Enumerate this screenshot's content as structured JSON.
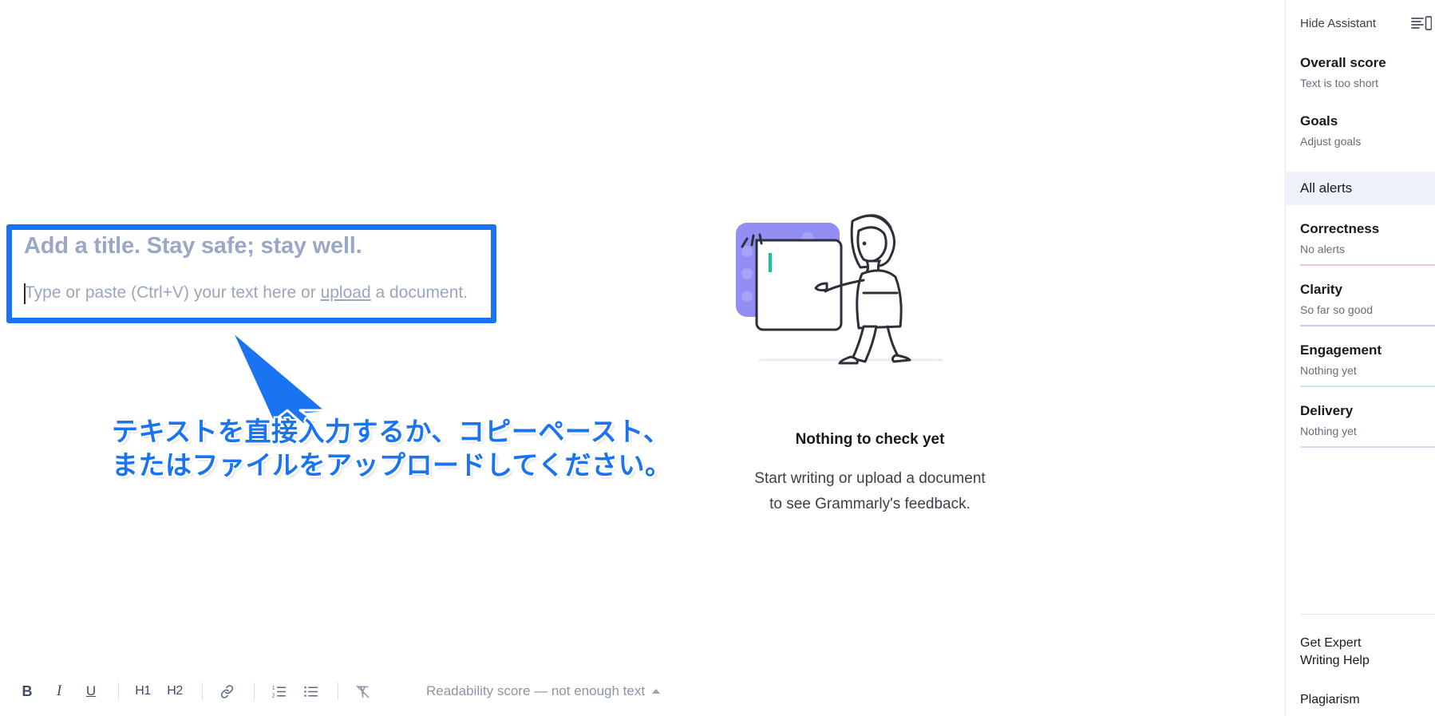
{
  "editor": {
    "title_placeholder": "Add a title. Stay safe; stay well.",
    "body_prefix": "Type or paste (Ctrl+V) your text here or ",
    "body_link": "upload",
    "body_suffix": " a document.",
    "highlight_color": "#1a73f0"
  },
  "annotation": {
    "line1": "テキストを直接入力するか、コピーペースト、",
    "line2": "またはファイルをアップロードしてください。",
    "color": "#1a73f0",
    "arrow_icon": "arrow-pointer-icon"
  },
  "empty_state": {
    "illustration_icon": "person-at-document-illustration",
    "title": "Nothing to check yet",
    "subtitle_line1": "Start writing or upload a document",
    "subtitle_line2": "to see Grammarly's feedback."
  },
  "toolbar": {
    "bold_label": "B",
    "italic_label": "I",
    "underline_label": "U",
    "h1_label": "H1",
    "h2_label": "H2",
    "link_icon": "link-icon",
    "numbered_list_icon": "numbered-list-icon",
    "bulleted_list_icon": "bulleted-list-icon",
    "clear_format_icon": "clear-formatting-icon",
    "readability_text": "Readability score — not enough text"
  },
  "assistant": {
    "hide_label": "Hide Assistant",
    "panel_icon": "side-panel-icon",
    "overall": {
      "title": "Overall score",
      "status": "Text is too short"
    },
    "goals": {
      "title": "Goals",
      "status": "Adjust goals"
    },
    "all_alerts_label": "All alerts",
    "categories": [
      {
        "name": "Correctness",
        "status": "No alerts",
        "color": "#f7c6cf"
      },
      {
        "name": "Clarity",
        "status": "So far so good",
        "color": "#c3cdf2"
      },
      {
        "name": "Engagement",
        "status": "Nothing yet",
        "color": "#c3eddd"
      },
      {
        "name": "Delivery",
        "status": "Nothing yet",
        "color": "#e2d4f2"
      }
    ],
    "footer": {
      "expert_line1": "Get Expert",
      "expert_line2": "Writing Help",
      "expert_icon": "person-check-icon",
      "plagiarism_label": "Plagiarism",
      "plagiarism_icon": "quotation-marks-icon"
    }
  }
}
